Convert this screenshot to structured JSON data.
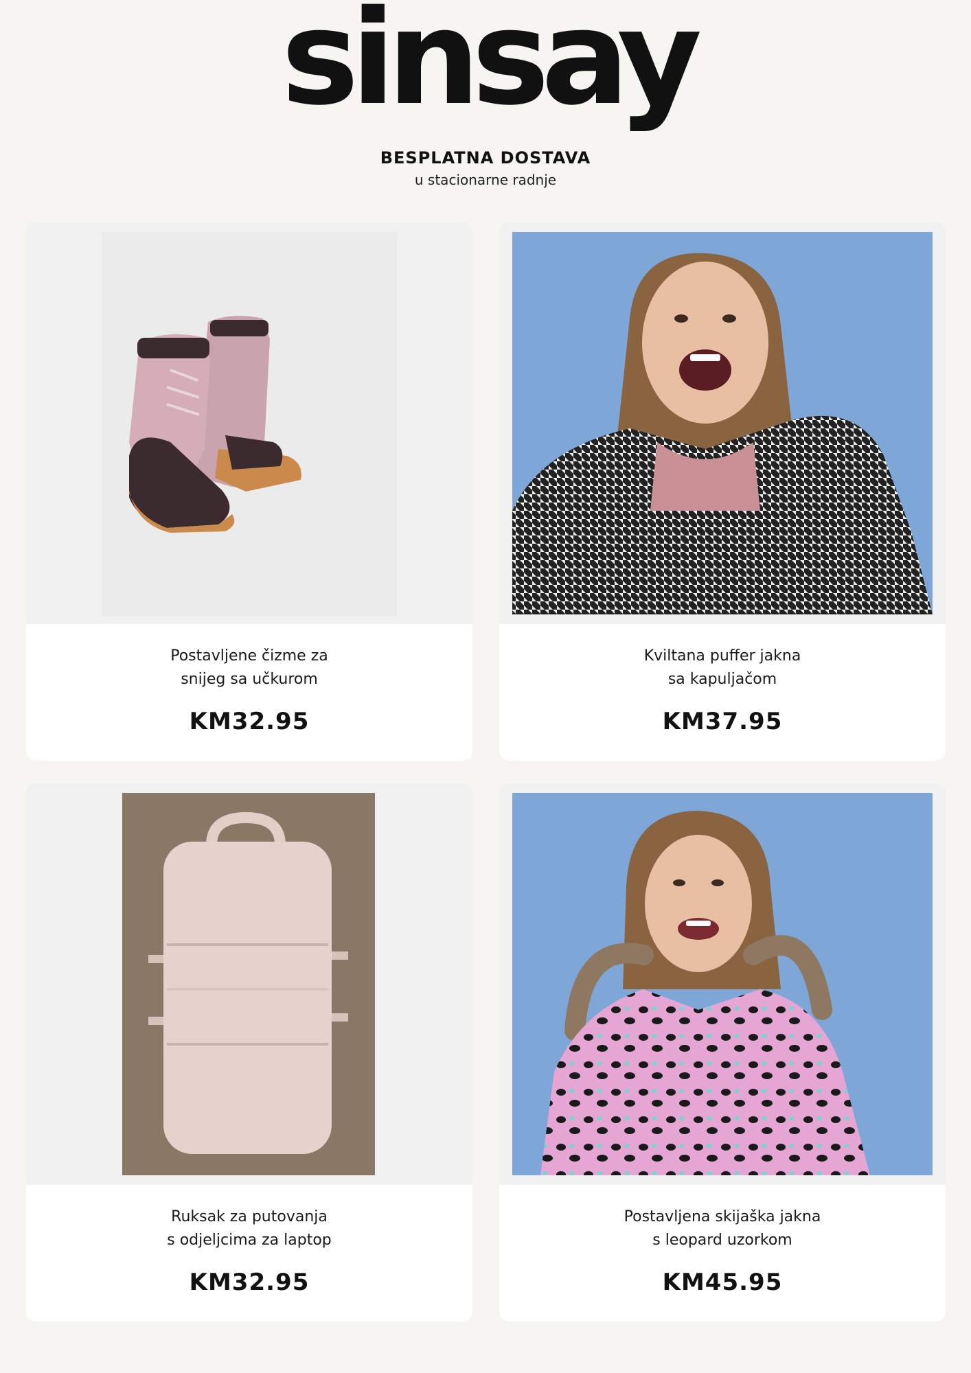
{
  "brand": {
    "logo_text": "sinsay"
  },
  "header": {
    "title": "BESPLATNA DOSTAVA",
    "subtitle": "u stacionarne radnje"
  },
  "products": [
    {
      "name_line1": "Postavljene čizme za",
      "name_line2": "snijeg sa učkurom",
      "price": "KM32.95",
      "image_icon": "snow-boots-image"
    },
    {
      "name_line1": "Kviltana puffer jakna",
      "name_line2": "sa kapuljačom",
      "price": "KM37.95",
      "image_icon": "girl-houndstooth-jacket-image"
    },
    {
      "name_line1": "Ruksak za putovanja",
      "name_line2": "s odjeljcima za laptop",
      "price": "KM32.95",
      "image_icon": "backpack-image"
    },
    {
      "name_line1": "Postavljena skijaška jakna",
      "name_line2": "s leopard uzorkom",
      "price": "KM45.95",
      "image_icon": "girl-leopard-ski-jacket-image"
    }
  ],
  "colors": {
    "background": "#f6f5f2",
    "photo_blue": "#7ea7d8",
    "card": "#ffffff"
  }
}
